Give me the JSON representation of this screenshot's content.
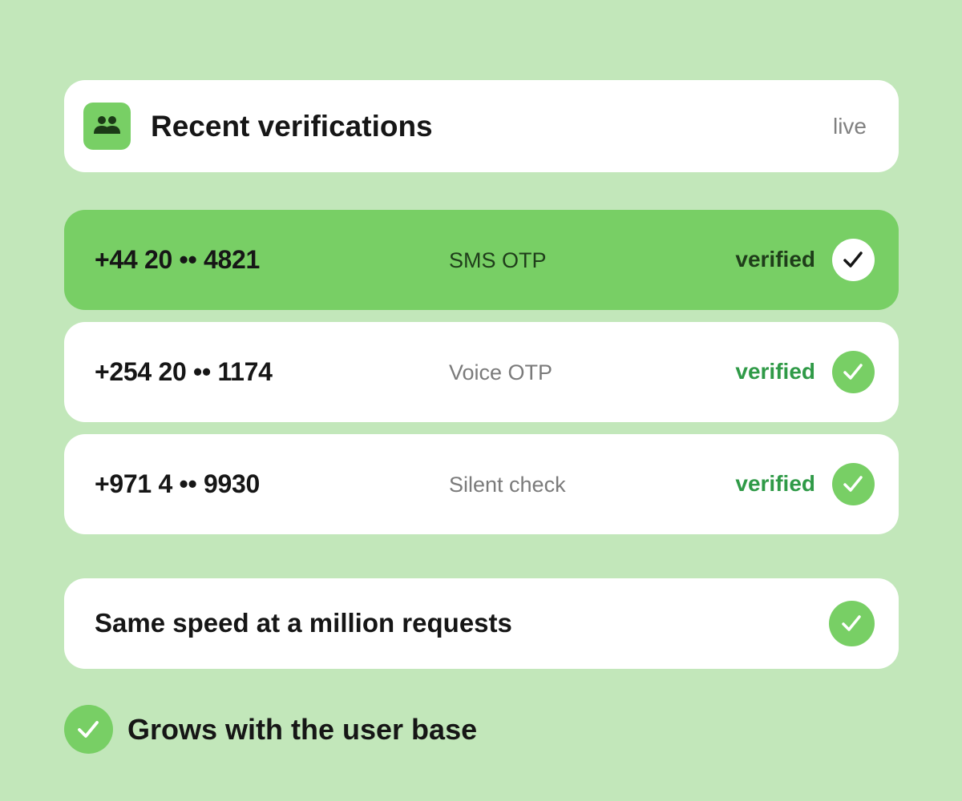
{
  "header": {
    "icon": "users-icon",
    "title": "Recent verifications",
    "status": "live"
  },
  "verifications": [
    {
      "phone": "+44 20 •• 4821",
      "method": "SMS OTP",
      "status": "verified",
      "active": true,
      "icon": "checkmark-icon"
    },
    {
      "phone": "+254 20 •• 1174",
      "method": "Voice OTP",
      "status": "verified",
      "active": false,
      "icon": "checkmark-icon"
    },
    {
      "phone": "+971 4 •• 9930",
      "method": "Silent check",
      "status": "verified",
      "active": false,
      "icon": "checkmark-icon"
    }
  ],
  "feature_card": {
    "text": "Same speed at a million requests",
    "icon": "checkmark-icon"
  },
  "bottom_feature": {
    "text": "Grows with the user base",
    "icon": "checkmark-icon"
  },
  "colors": {
    "background": "#c2e7ba",
    "accent": "#78cf65",
    "verified_text": "#2f9a47",
    "card": "#ffffff"
  }
}
